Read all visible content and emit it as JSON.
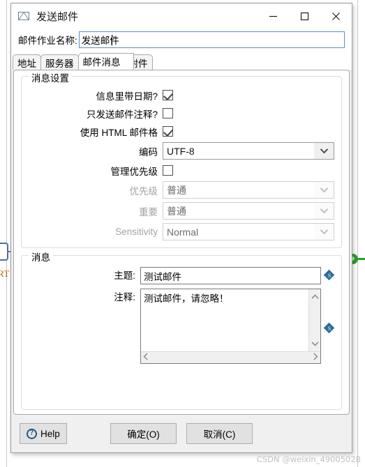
{
  "window": {
    "title": "发送邮件",
    "icon": "envelope-icon",
    "controls": {
      "minimize": "minimize-icon",
      "maximize": "maximize-icon",
      "close": "close-icon"
    }
  },
  "job": {
    "label": "邮件作业名称:",
    "value": "发送邮件"
  },
  "tabs": [
    {
      "label": "地址",
      "active": false
    },
    {
      "label": "服务器",
      "active": false
    },
    {
      "label": "邮件消息",
      "active": true
    },
    {
      "label": "附件",
      "active": false
    }
  ],
  "message_settings": {
    "legend": "消息设置",
    "checkboxes": [
      {
        "label": "信息里带日期?",
        "checked": true
      },
      {
        "label": "只发送邮件注释?",
        "checked": false
      },
      {
        "label": "使用 HTML 邮件格",
        "checked": true
      }
    ],
    "encoding": {
      "label": "编码",
      "value": "UTF-8",
      "disabled": false
    },
    "manage_priority": {
      "label": "管理优先级",
      "checked": false
    },
    "priority": {
      "label": "优先级",
      "value": "普通",
      "disabled": true
    },
    "importance": {
      "label": "重要",
      "value": "普通",
      "disabled": true
    },
    "sensitivity": {
      "label": "Sensitivity",
      "value": "Normal",
      "disabled": true
    }
  },
  "message": {
    "legend": "消息",
    "subject": {
      "label": "主题:",
      "value": "测试邮件"
    },
    "comment": {
      "label": "注释:",
      "value": "测试邮件，请忽略！"
    },
    "variable_icon": "variable-diamond-icon"
  },
  "footer": {
    "help": "Help",
    "ok": "确定(O)",
    "cancel": "取消(C)"
  },
  "watermark": "CSDN @weixin_49005028",
  "background": {
    "left_label": "RT",
    "left_node": "flow-node-left",
    "right_node": "flow-node-right"
  },
  "colors": {
    "accent": "#5a8fc4",
    "title_bar": "#ffffff",
    "dialog_bg": "#f0f0f0",
    "help_icon": "#1f5b8a",
    "variable_icon": "#2e6d99",
    "green_node": "#2aa02a"
  }
}
